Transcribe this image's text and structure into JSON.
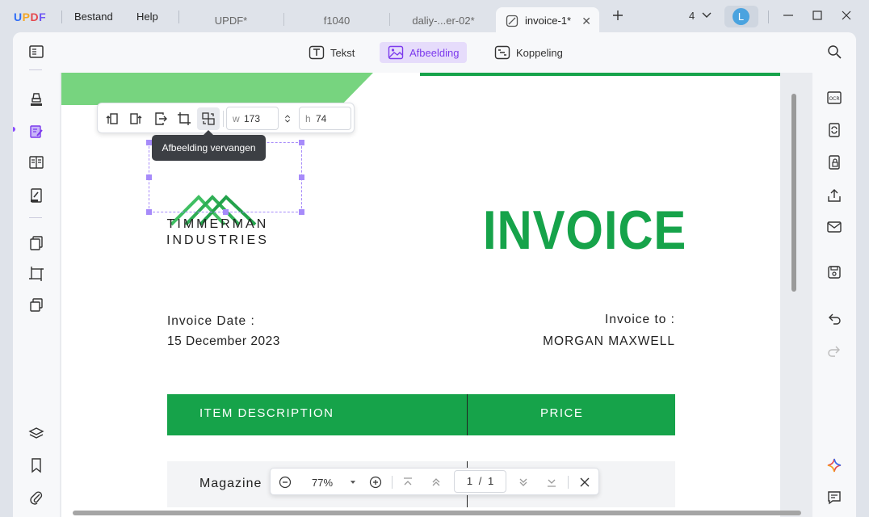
{
  "app": {
    "logo": "UPDF"
  },
  "menu": {
    "file": "Bestand",
    "help": "Help"
  },
  "tabs": [
    {
      "label": "UPDF*"
    },
    {
      "label": "f1040"
    },
    {
      "label": "daliy-...er-02*"
    },
    {
      "label": "invoice-1*",
      "active": true
    }
  ],
  "window": {
    "tab_count": "4",
    "avatar_letter": "L"
  },
  "modes": {
    "text": "Tekst",
    "image": "Afbeelding",
    "link": "Koppeling"
  },
  "image_toolbar": {
    "width_label": "w",
    "width_value": "173",
    "height_label": "h",
    "height_value": "74",
    "tooltip": "Afbeelding vervangen"
  },
  "document": {
    "company_line1": "TIMMERMAN",
    "company_line2": "INDUSTRIES",
    "title": "INVOICE",
    "date_label": "Invoice Date :",
    "date_value": "15 December 2023",
    "to_label": "Invoice to :",
    "to_value": "MORGAN MAXWELL",
    "table_headers": [
      "ITEM DESCRIPTION",
      "PRICE"
    ],
    "rows": [
      {
        "item": "Magazine"
      }
    ]
  },
  "zoom": {
    "level": "77%",
    "current_page": "1",
    "separator": "/",
    "total_pages": "1"
  },
  "colors": {
    "accent": "#16a34a",
    "selection": "#a78bfa",
    "mode_active": "#7c3aed"
  }
}
